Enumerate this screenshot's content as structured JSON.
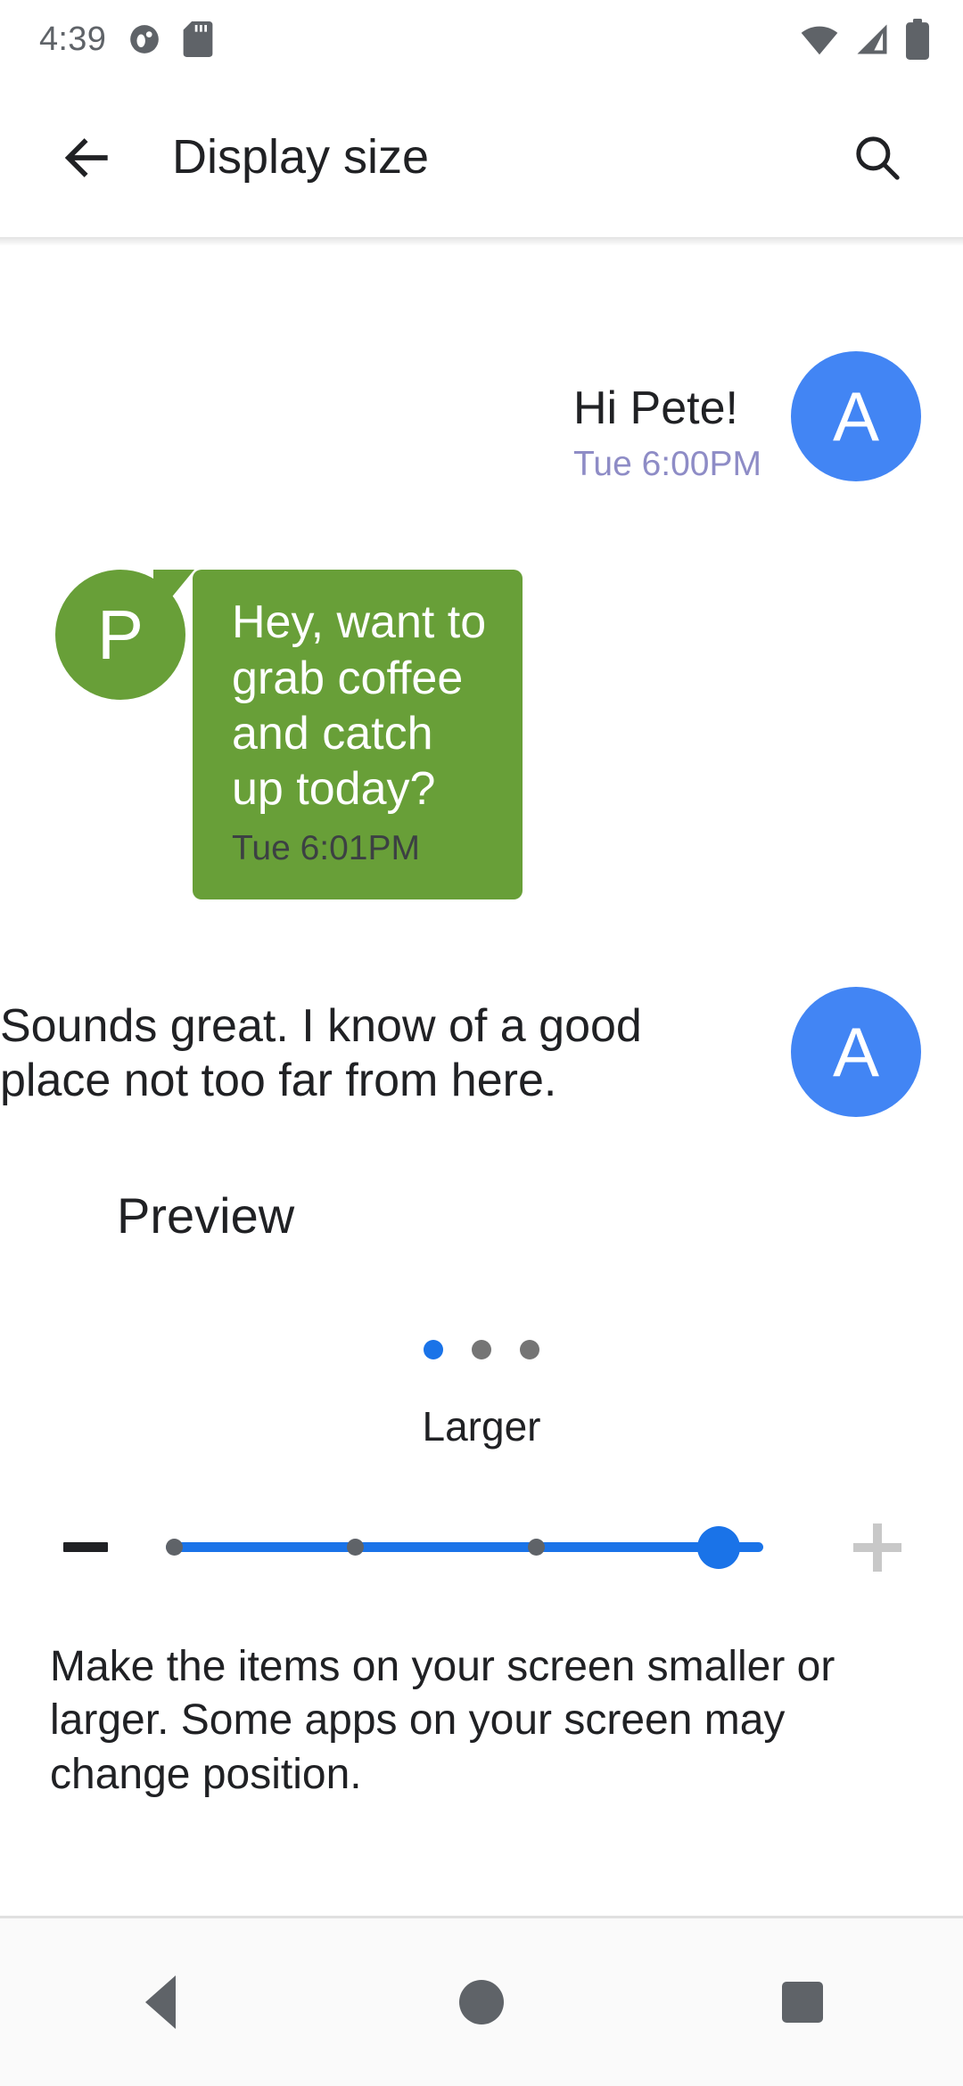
{
  "status_bar": {
    "clock": "4:39",
    "left_icons": [
      {
        "name": "notification-dot-icon"
      },
      {
        "name": "sd-card-icon"
      }
    ],
    "right_icons": [
      {
        "name": "wifi-icon"
      },
      {
        "name": "cellular-signal-icon"
      },
      {
        "name": "battery-full-icon"
      }
    ]
  },
  "app_bar": {
    "back_icon": "arrow-back-icon",
    "title": "Display size",
    "search_icon": "search-icon"
  },
  "preview": {
    "label": "Preview",
    "messages": [
      {
        "id": "msg-1",
        "avatar_initial": "A",
        "avatar_color": "#4285f4",
        "align": "right",
        "style": "plain",
        "text": "Hi Pete!",
        "time": "Tue 6:00PM"
      },
      {
        "id": "msg-2",
        "avatar_initial": "P",
        "avatar_color": "#689f38",
        "align": "left",
        "style": "bubble",
        "bubble_color": "#689f38",
        "text": "Hey, want to grab coffee and catch up today?",
        "time": "Tue 6:01PM"
      },
      {
        "id": "msg-3",
        "avatar_initial": "A",
        "avatar_color": "#4285f4",
        "align": "right",
        "style": "plain",
        "text": "Sounds great. I know of a good place not too far from here.",
        "time": ""
      }
    ]
  },
  "pager": {
    "total": 3,
    "active_index": 0,
    "active_color": "#1a73e8",
    "inactive_color": "#757575"
  },
  "size_control": {
    "current_label": "Larger",
    "decrease_icon": "minus-icon",
    "increase_icon": "plus-icon",
    "decrease_enabled": true,
    "increase_enabled": false,
    "steps": 4,
    "value_index": 3,
    "accent_color": "#1a73e8"
  },
  "description": "Make the items on your screen smaller or larger. Some apps on your screen may change position.",
  "nav_bar": {
    "back_icon": "nav-back-triangle-icon",
    "home_icon": "nav-home-circle-icon",
    "recents_icon": "nav-recents-square-icon"
  }
}
